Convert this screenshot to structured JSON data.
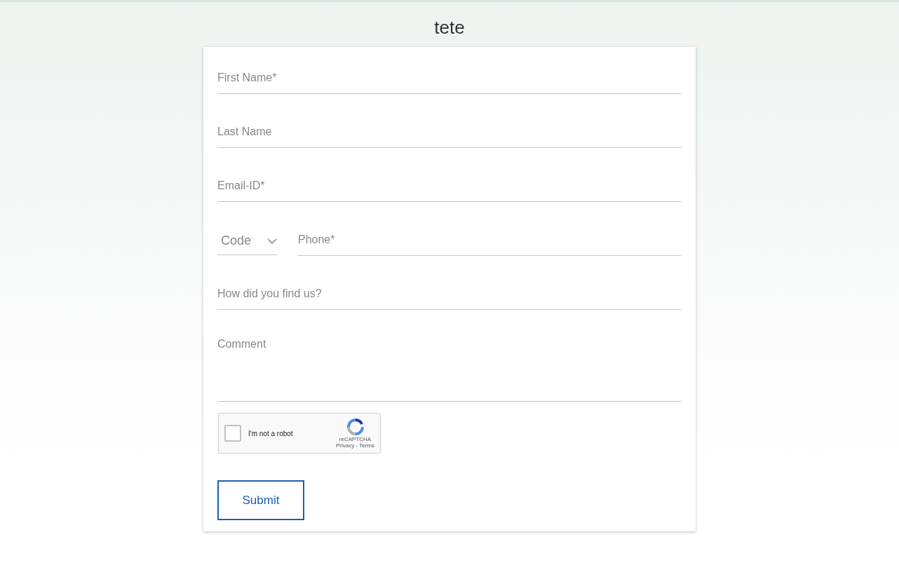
{
  "title": "tete",
  "fields": [
    {
      "kind": "text",
      "placeholder": "First Name*"
    },
    {
      "kind": "text",
      "placeholder": "Last Name"
    },
    {
      "kind": "text",
      "placeholder": "Email-ID*"
    },
    {
      "kind": "phone",
      "code": "Code",
      "placeholder": "Phone*"
    },
    {
      "kind": "text",
      "placeholder": "How did you find us?"
    },
    {
      "kind": "textarea",
      "placeholder": "Comment"
    }
  ],
  "captcha": {
    "label": "I'm not a robot",
    "checked": false,
    "brand": "reCAPTCHA",
    "links": "Privacy - Terms"
  },
  "submit": "Submit"
}
